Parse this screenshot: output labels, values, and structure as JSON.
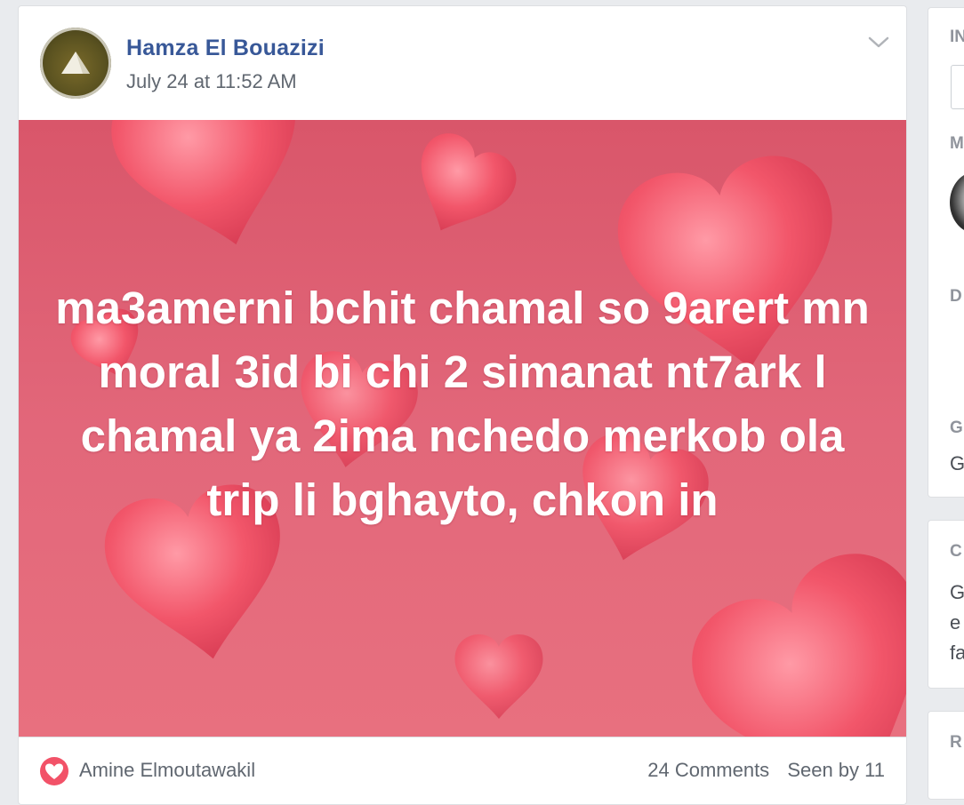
{
  "post": {
    "author": "Hamza El Bouazizi",
    "timestamp": "July 24 at 11:52 AM",
    "text": "ma3amerni bchit chamal so 9arert mn moral 3id bi chi 2 simanat nt7ark l chamal ya 2ima nchedo merkob ola trip li bghayto, chkon in",
    "background_color": "#e2677a",
    "text_color": "#ffffff",
    "author_color": "#385898"
  },
  "reactions": {
    "icon": "love-icon",
    "reactor_name": "Amine Elmoutawakil",
    "comments": "24 Comments",
    "seen_by": "Seen by 11"
  },
  "sidebar": {
    "card1_heading": "IN",
    "card1_label_m": "M",
    "card1_label_d": "D",
    "card1_label_g": "G",
    "card1_text_g": "G",
    "card2_heading": "C",
    "card2_line1": "G",
    "card2_line2": "e",
    "card2_line3": "fa",
    "card3_heading": "R"
  },
  "icons": {
    "menu": "chevron-down-icon",
    "avatar": "profile-photo"
  }
}
